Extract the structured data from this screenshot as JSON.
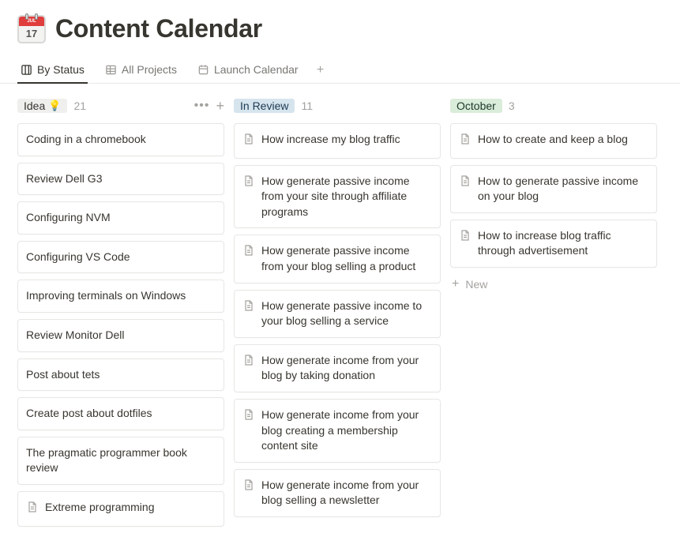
{
  "header": {
    "icon_day": "17",
    "title": "Content Calendar"
  },
  "tabs": [
    {
      "label": "By Status",
      "icon": "board-icon",
      "active": true
    },
    {
      "label": "All Projects",
      "icon": "table-icon",
      "active": false
    },
    {
      "label": "Launch Calendar",
      "icon": "calendar-icon",
      "active": false
    }
  ],
  "columns": {
    "idea": {
      "label": "Idea",
      "emoji": "💡",
      "count": "21",
      "show_actions": true,
      "cards": [
        {
          "title": "Coding in a chromebook",
          "icon": false
        },
        {
          "title": "Review Dell G3",
          "icon": false
        },
        {
          "title": "Configuring NVM",
          "icon": false
        },
        {
          "title": "Configuring VS Code",
          "icon": false
        },
        {
          "title": "Improving terminals on Windows",
          "icon": false
        },
        {
          "title": "Review Monitor Dell",
          "icon": false
        },
        {
          "title": "Post about tets",
          "icon": false
        },
        {
          "title": "Create post about dotfiles",
          "icon": false
        },
        {
          "title": "The pragmatic programmer book review",
          "icon": false
        },
        {
          "title": "Extreme programming",
          "icon": true
        }
      ]
    },
    "in_review": {
      "label": "In Review",
      "count": "11",
      "cards": [
        {
          "title": "How increase my blog traffic",
          "icon": true
        },
        {
          "title": "How generate passive income from your site through affiliate programs",
          "icon": true
        },
        {
          "title": "How generate passive income from your blog selling a product",
          "icon": true
        },
        {
          "title": "How generate passive income to your blog selling a service",
          "icon": true
        },
        {
          "title": "How generate income from your blog by taking donation",
          "icon": true
        },
        {
          "title": "How generate income from your blog creating a membership content site",
          "icon": true
        },
        {
          "title": "How generate income from your blog selling a newsletter",
          "icon": true
        }
      ]
    },
    "october": {
      "label": "October",
      "count": "3",
      "new_label": "New",
      "cards": [
        {
          "title": "How to create and keep a blog",
          "icon": true
        },
        {
          "title": "How to generate passive income on your blog",
          "icon": true
        },
        {
          "title": "How to increase blog traffic through advertisement",
          "icon": true
        }
      ]
    }
  }
}
